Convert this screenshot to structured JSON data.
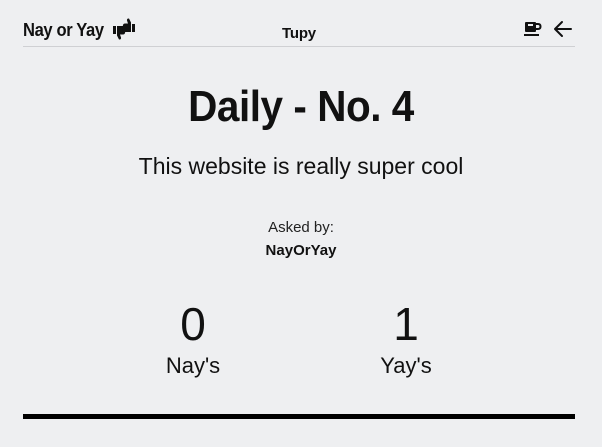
{
  "header": {
    "brand": "Nay or Yay",
    "brand_icon": "thumbs-up-down-icon",
    "center_title": "Tupy",
    "actions": [
      {
        "name": "coffee-icon"
      },
      {
        "name": "back-arrow-icon"
      }
    ]
  },
  "main": {
    "title": "Daily - No. 4",
    "question": "This website is really super cool",
    "asked_label": "Asked by:",
    "asked_by": "NayOrYay"
  },
  "stats": {
    "nay": {
      "count": "0",
      "label": "Nay's"
    },
    "yay": {
      "count": "1",
      "label": "Yay's"
    }
  },
  "colors": {
    "background": "#eeeff1",
    "text": "#111111",
    "divider": "#cfd0d3",
    "bar": "#000000"
  }
}
